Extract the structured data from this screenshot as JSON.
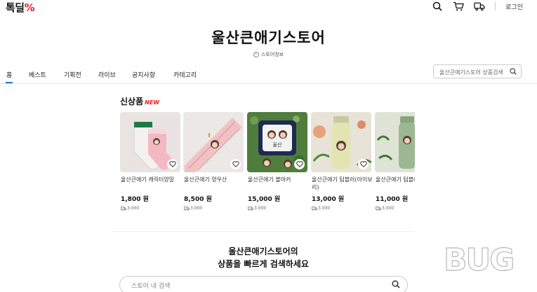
{
  "header": {
    "logo_text": "톡딜",
    "logo_accent": "%",
    "login_label": "로그인",
    "icons": [
      "search-icon",
      "cart-icon",
      "delivery-truck-icon"
    ]
  },
  "store": {
    "title": "울산큰애기스토어",
    "info_label": "스토어정보"
  },
  "nav": {
    "tabs": [
      {
        "label": "홈",
        "active": true
      },
      {
        "label": "베스트"
      },
      {
        "label": "기획전"
      },
      {
        "label": "라이브"
      },
      {
        "label": "공지사항"
      },
      {
        "label": "카테고리"
      }
    ],
    "search_placeholder": "울산큰애기스토어 상품검색"
  },
  "new_products": {
    "title": "신상품",
    "badge": "NEW",
    "items": [
      {
        "name": "울산큰애기 캐릭터양말",
        "price": "1,800 원",
        "shipping": "3,000"
      },
      {
        "name": "울산큰애기 양우산",
        "price": "8,500 원",
        "shipping": "3,000"
      },
      {
        "name": "울산큰애기 볼마커",
        "price": "15,000 원",
        "shipping": "3,000"
      },
      {
        "name": "울산큰애기 텀블러(아이보리)",
        "price": "13,000 원",
        "shipping": "3,000"
      },
      {
        "name": "울산큰애기 텀블러(그린)",
        "price": "11,000 원",
        "shipping": "3,000"
      }
    ]
  },
  "store_search": {
    "heading_line1": "울산큰애기스토어의",
    "heading_line2": "상품을 빠르게 검색하세요",
    "placeholder": "스토어 내 검색"
  },
  "watermark": {
    "text": "BUG"
  },
  "colors": {
    "accent_red": "#e8202a",
    "tab_active": "#2a6fd8"
  }
}
